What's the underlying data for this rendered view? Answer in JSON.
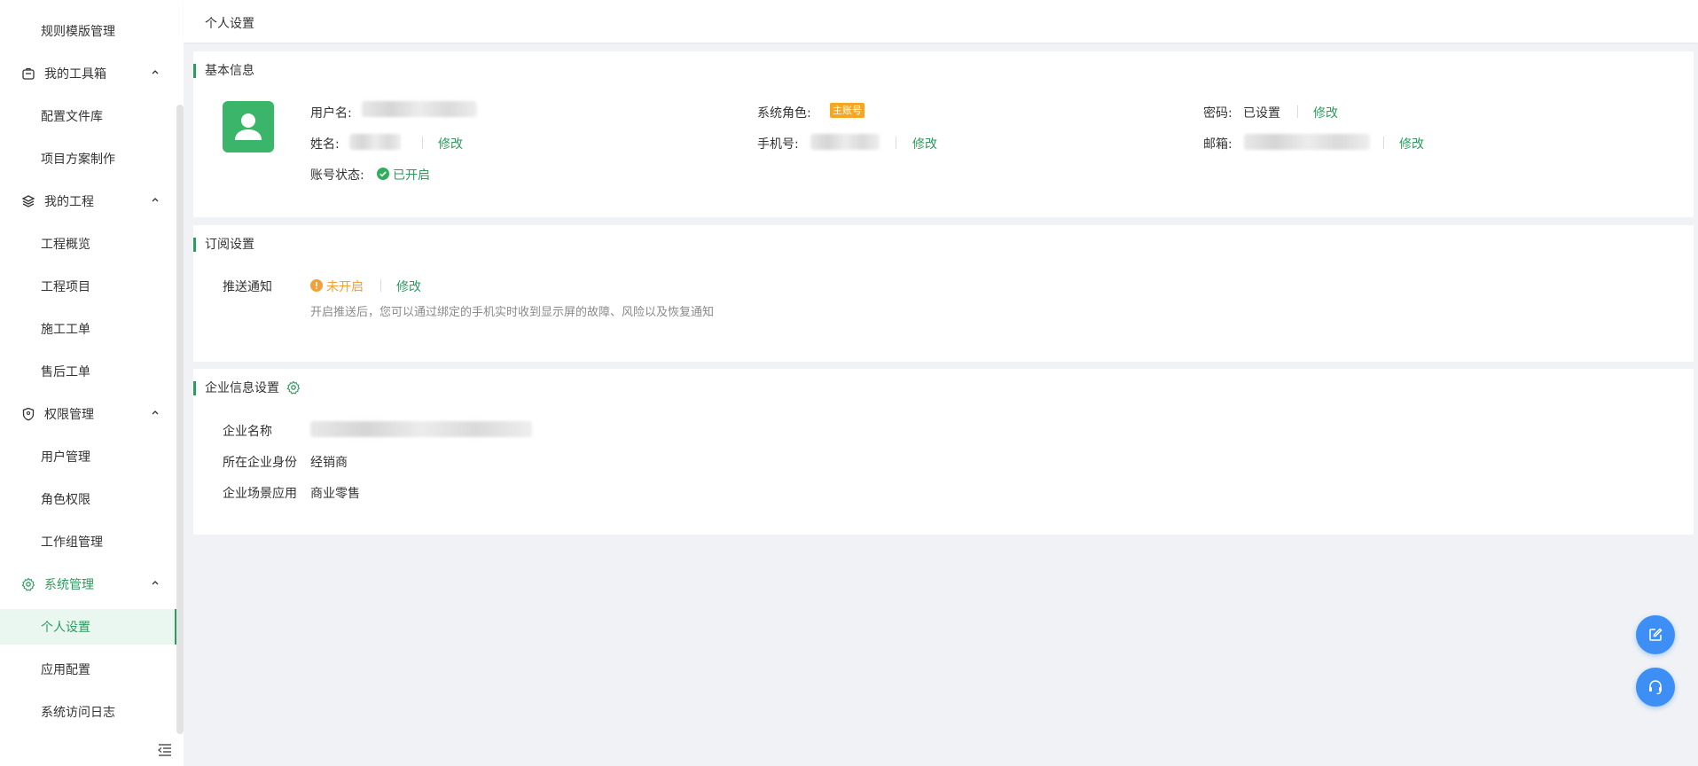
{
  "sidebar": {
    "top_item": "规则模版管理",
    "groups": [
      {
        "label": "我的工具箱",
        "icon": "toolbox-icon",
        "items": [
          "配置文件库",
          "项目方案制作"
        ]
      },
      {
        "label": "我的工程",
        "icon": "layers-icon",
        "items": [
          "工程概览",
          "工程项目",
          "施工工单",
          "售后工单"
        ]
      },
      {
        "label": "权限管理",
        "icon": "shield-icon",
        "items": [
          "用户管理",
          "角色权限",
          "工作组管理"
        ]
      },
      {
        "label": "系统管理",
        "icon": "gear-icon",
        "items": [
          "个人设置",
          "应用配置",
          "系统访问日志"
        ]
      }
    ],
    "active_item": "个人设置"
  },
  "header": {
    "breadcrumb": "个人设置"
  },
  "basic": {
    "title": "基本信息",
    "username_label": "用户名:",
    "name_label": "姓名:",
    "name_edit": "修改",
    "account_status_label": "账号状态:",
    "account_status_value": "已开启",
    "role_label": "系统角色:",
    "role_badge": "主账号",
    "phone_label": "手机号:",
    "phone_edit": "修改",
    "password_label": "密码:",
    "password_value": "已设置",
    "password_edit": "修改",
    "email_label": "邮箱:",
    "email_edit": "修改"
  },
  "subscription": {
    "title": "订阅设置",
    "push_label": "推送通知",
    "push_status": "未开启",
    "push_edit": "修改",
    "push_hint": "开启推送后，您可以通过绑定的手机实时收到显示屏的故障、风险以及恢复通知"
  },
  "company": {
    "title": "企业信息设置",
    "name_label": "企业名称",
    "identity_label": "所在企业身份",
    "identity_value": "经销商",
    "scenario_label": "企业场景应用",
    "scenario_value": "商业零售"
  },
  "colors": {
    "accent": "#2d9a5e",
    "warning": "#f0a13a",
    "fab": "#3d8ff5"
  }
}
